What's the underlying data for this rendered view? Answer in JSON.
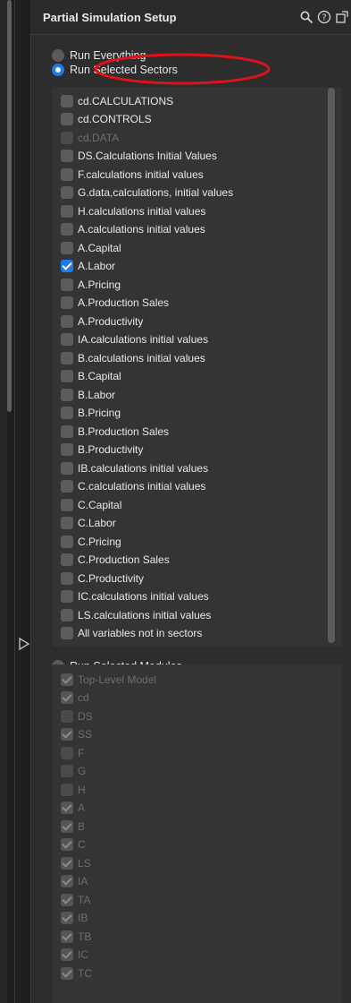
{
  "title": "Partial Simulation Setup",
  "icons": [
    "search-icon",
    "help-icon",
    "export-icon",
    "disclosure-triangle-icon"
  ],
  "run_mode": {
    "everything_label": "Run Everything",
    "selected_sectors_label": "Run Selected Sectors",
    "selected_modules_label": "Run Selected Modules",
    "selected": "selected_sectors"
  },
  "sectors": [
    {
      "label": "cd.CALCULATIONS",
      "checked": false,
      "disabled": false
    },
    {
      "label": "cd.CONTROLS",
      "checked": false,
      "disabled": false
    },
    {
      "label": "cd.DATA",
      "checked": false,
      "disabled": true
    },
    {
      "label": "DS.Calculations  Initial Values",
      "checked": false,
      "disabled": false
    },
    {
      "label": "F.calculations  initial values",
      "checked": false,
      "disabled": false
    },
    {
      "label": "G.data,calculations, initial values",
      "checked": false,
      "disabled": false
    },
    {
      "label": "H.calculations  initial values",
      "checked": false,
      "disabled": false
    },
    {
      "label": "A.calculations  initial values",
      "checked": false,
      "disabled": false
    },
    {
      "label": "A.Capital",
      "checked": false,
      "disabled": false
    },
    {
      "label": "A.Labor",
      "checked": true,
      "disabled": false
    },
    {
      "label": "A.Pricing",
      "checked": false,
      "disabled": false
    },
    {
      "label": "A.Production  Sales",
      "checked": false,
      "disabled": false
    },
    {
      "label": "A.Productivity",
      "checked": false,
      "disabled": false
    },
    {
      "label": "IA.calculations  initial values",
      "checked": false,
      "disabled": false
    },
    {
      "label": "B.calculations  initial values",
      "checked": false,
      "disabled": false
    },
    {
      "label": "B.Capital",
      "checked": false,
      "disabled": false
    },
    {
      "label": "B.Labor",
      "checked": false,
      "disabled": false
    },
    {
      "label": "B.Pricing",
      "checked": false,
      "disabled": false
    },
    {
      "label": "B.Production  Sales",
      "checked": false,
      "disabled": false
    },
    {
      "label": "B.Productivity",
      "checked": false,
      "disabled": false
    },
    {
      "label": "IB.calculations  initial values",
      "checked": false,
      "disabled": false
    },
    {
      "label": "C.calculations  initial values",
      "checked": false,
      "disabled": false
    },
    {
      "label": "C.Capital",
      "checked": false,
      "disabled": false
    },
    {
      "label": "C.Labor",
      "checked": false,
      "disabled": false
    },
    {
      "label": "C.Pricing",
      "checked": false,
      "disabled": false
    },
    {
      "label": "C.Production  Sales",
      "checked": false,
      "disabled": false
    },
    {
      "label": "C.Productivity",
      "checked": false,
      "disabled": false
    },
    {
      "label": "IC.calculations  initial values",
      "checked": false,
      "disabled": false
    },
    {
      "label": "LS.calculations  initial values",
      "checked": false,
      "disabled": false
    },
    {
      "label": "All variables not in sectors",
      "checked": false,
      "disabled": false
    }
  ],
  "modules": [
    {
      "label": "Top-Level Model",
      "checked": true
    },
    {
      "label": "cd",
      "checked": true
    },
    {
      "label": "DS",
      "checked": false
    },
    {
      "label": "SS",
      "checked": true
    },
    {
      "label": "F",
      "checked": false
    },
    {
      "label": "G",
      "checked": false
    },
    {
      "label": "H",
      "checked": false
    },
    {
      "label": "A",
      "checked": true
    },
    {
      "label": "B",
      "checked": true
    },
    {
      "label": "C",
      "checked": true
    },
    {
      "label": "LS",
      "checked": true
    },
    {
      "label": "IA",
      "checked": true
    },
    {
      "label": "TA",
      "checked": true
    },
    {
      "label": "IB",
      "checked": true
    },
    {
      "label": "TB",
      "checked": true
    },
    {
      "label": "IC",
      "checked": true
    },
    {
      "label": "TC",
      "checked": true
    }
  ],
  "colors": {
    "accent": "#1a7cf0",
    "annotation": "#e0101a"
  }
}
